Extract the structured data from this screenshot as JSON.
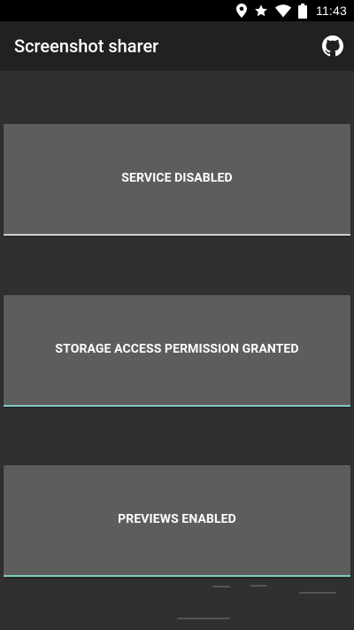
{
  "status_bar": {
    "time": "11:43",
    "icons": [
      "location-icon",
      "star-icon",
      "wifi-icon",
      "battery-icon"
    ]
  },
  "app_bar": {
    "title": "Screenshot sharer",
    "action_icon": "github-icon"
  },
  "buttons": {
    "service": {
      "label": "SERVICE DISABLED",
      "state": "off"
    },
    "storage": {
      "label": "STORAGE ACCESS PERMISSION GRANTED",
      "state": "on"
    },
    "previews": {
      "label": "PREVIEWS ENABLED",
      "state": "on"
    }
  },
  "colors": {
    "background": "#303030",
    "app_bar": "#212121",
    "button": "#5d5d5d",
    "indicator_on": "#80cbc4",
    "indicator_off": "#cfcfcf"
  }
}
